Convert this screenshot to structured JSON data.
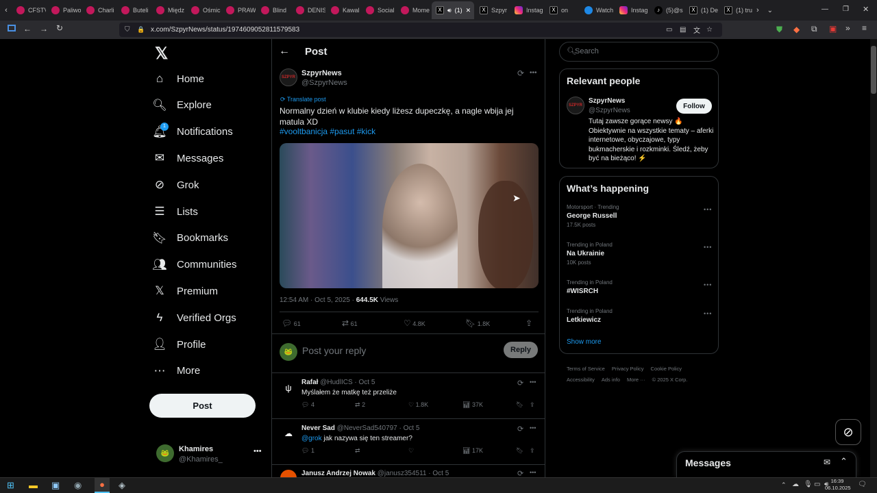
{
  "browser": {
    "tabs": [
      {
        "label": "CFSTV",
        "fav": "pin"
      },
      {
        "label": "Paliwo",
        "fav": "pin"
      },
      {
        "label": "Charli",
        "fav": "pin"
      },
      {
        "label": "Buteli",
        "fav": "pin"
      },
      {
        "label": "Międz",
        "fav": "pin"
      },
      {
        "label": "Ośmic",
        "fav": "pin"
      },
      {
        "label": "PRAW",
        "fav": "pin"
      },
      {
        "label": "Blind",
        "fav": "pin"
      },
      {
        "label": "DENIS",
        "fav": "pin"
      },
      {
        "label": "Kawal",
        "fav": "pin"
      },
      {
        "label": "Social",
        "fav": "pin"
      },
      {
        "label": "Mome",
        "fav": "pin"
      },
      {
        "label": "(1)",
        "fav": "x",
        "active": true
      },
      {
        "label": "Szpyr",
        "fav": "x"
      },
      {
        "label": "Instag",
        "fav": "ig"
      },
      {
        "label": "on",
        "fav": "x"
      },
      {
        "label": "Watch",
        "fav": "w"
      },
      {
        "label": "Instag",
        "fav": "ig"
      },
      {
        "label": "(5)@s",
        "fav": "tt"
      },
      {
        "label": "(1) De",
        "fav": "x"
      },
      {
        "label": "(1) tru",
        "fav": "x"
      }
    ],
    "url": "x.com/SzpyrNews/status/1974609052811579583"
  },
  "nav": {
    "items": [
      {
        "label": "Home",
        "icon": "home-icon"
      },
      {
        "label": "Explore",
        "icon": "search-icon"
      },
      {
        "label": "Notifications",
        "icon": "bell-icon",
        "badge": "1"
      },
      {
        "label": "Messages",
        "icon": "envelope-icon"
      },
      {
        "label": "Grok",
        "icon": "grok-icon"
      },
      {
        "label": "Lists",
        "icon": "list-icon"
      },
      {
        "label": "Bookmarks",
        "icon": "bookmark-icon"
      },
      {
        "label": "Communities",
        "icon": "people-icon"
      },
      {
        "label": "Premium",
        "icon": "x-logo-icon"
      },
      {
        "label": "Verified Orgs",
        "icon": "lightning-icon"
      },
      {
        "label": "Profile",
        "icon": "person-icon"
      },
      {
        "label": "More",
        "icon": "more-circle-icon"
      }
    ],
    "post_button": "Post",
    "account": {
      "name": "Khamires",
      "handle": "@Khamires_"
    }
  },
  "post": {
    "header": "Post",
    "author": "SzpyrNews",
    "handle": "@SzpyrNews",
    "translate": "Translate post",
    "text": "Normalny dzień w klubie kiedy liżesz dupeczkę, a nagle wbija jej matula XD",
    "hashtags": "#vooltbanicja #pasut #kick",
    "time": "12:54 AM · Oct 5, 2025 · ",
    "views_count": "644.5K",
    "views_label": " Views",
    "stats": {
      "replies": "61",
      "reposts": "61",
      "likes": "4.8K",
      "bookmarks": "1.8K"
    },
    "reply_placeholder": "Post your reply",
    "reply_button": "Reply"
  },
  "replies": [
    {
      "name": "Rafał",
      "handle": "@HudlICS · Oct 5",
      "text": "Myślałem że matkę też przeliże",
      "replies": "4",
      "reposts": "2",
      "likes": "1.8K",
      "views": "37K"
    },
    {
      "name": "Never Sad",
      "handle": "@NeverSad540797 · Oct 5",
      "mention": "@grok",
      "text": " jak nazywa się ten streamer?",
      "replies": "1",
      "reposts": "",
      "likes": "",
      "views": "17K"
    },
    {
      "name": "Janusz Andrzej Nowak",
      "handle": "@janusz354511 · Oct 5"
    }
  ],
  "sidebar": {
    "search_placeholder": "Search",
    "relevant_title": "Relevant people",
    "person": {
      "name": "SzpyrNews",
      "handle": "@SzpyrNews",
      "follow": "Follow",
      "bio": "Tutaj zawsze gorące newsy 🔥 Obiektywnie na wszystkie tematy – aferki internetowe, obyczajowe, typy bukmacherskie i rozkminki. Śledź, żeby być na bieżąco! ⚡"
    },
    "happening_title": "What’s happening",
    "trends": [
      {
        "context": "Motorsport · Trending",
        "name": "George Russell",
        "count": "17.5K posts"
      },
      {
        "context": "Trending in Poland",
        "name": "Na Ukrainie",
        "count": "10K posts"
      },
      {
        "context": "Trending in Poland",
        "name": "#WISRCH",
        "count": ""
      },
      {
        "context": "Trending in Poland",
        "name": "Letkiewicz",
        "count": ""
      }
    ],
    "show_more": "Show more",
    "footer_row1": [
      "Terms of Service",
      "Privacy Policy",
      "Cookie Policy"
    ],
    "footer_row2": [
      "Accessibility",
      "Ads info",
      "More ···",
      "© 2025 X Corp."
    ]
  },
  "messages_label": "Messages",
  "taskbar": {
    "time": "16:39",
    "date": "06.10.2025"
  }
}
